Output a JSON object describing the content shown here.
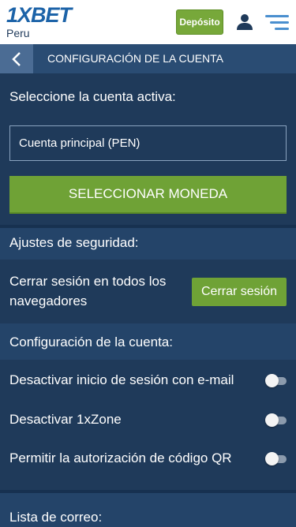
{
  "header": {
    "logo": "1XBET",
    "region": "Peru",
    "deposit_label": "Depósito",
    "user_icon": "user-icon",
    "menu_icon": "hamburger-menu-icon",
    "brand_color": "#1c63a8",
    "accent_color": "#6fa236"
  },
  "titlebar": {
    "back_icon": "chevron-left-icon",
    "title": "CONFIGURACIÓN DE LA CUENTA"
  },
  "account": {
    "heading": "Seleccione la cuenta activa:",
    "selected": "Cuenta principal (PEN)",
    "currency_button": "SELECCIONAR MONEDA"
  },
  "security": {
    "heading": "Ajustes de seguridad:",
    "logout_all_text": "Cerrar sesión en todos los navegadores",
    "logout_button": "Cerrar sesión"
  },
  "settings": {
    "heading": "Configuración de la cuenta:",
    "toggles": [
      {
        "label": "Desactivar inicio de sesión con e-mail",
        "on": false
      },
      {
        "label": "Desactivar 1xZone",
        "on": false
      },
      {
        "label": "Permitir la autorización de código QR",
        "on": false
      }
    ]
  },
  "mailing": {
    "heading": "Lista de correo:"
  }
}
